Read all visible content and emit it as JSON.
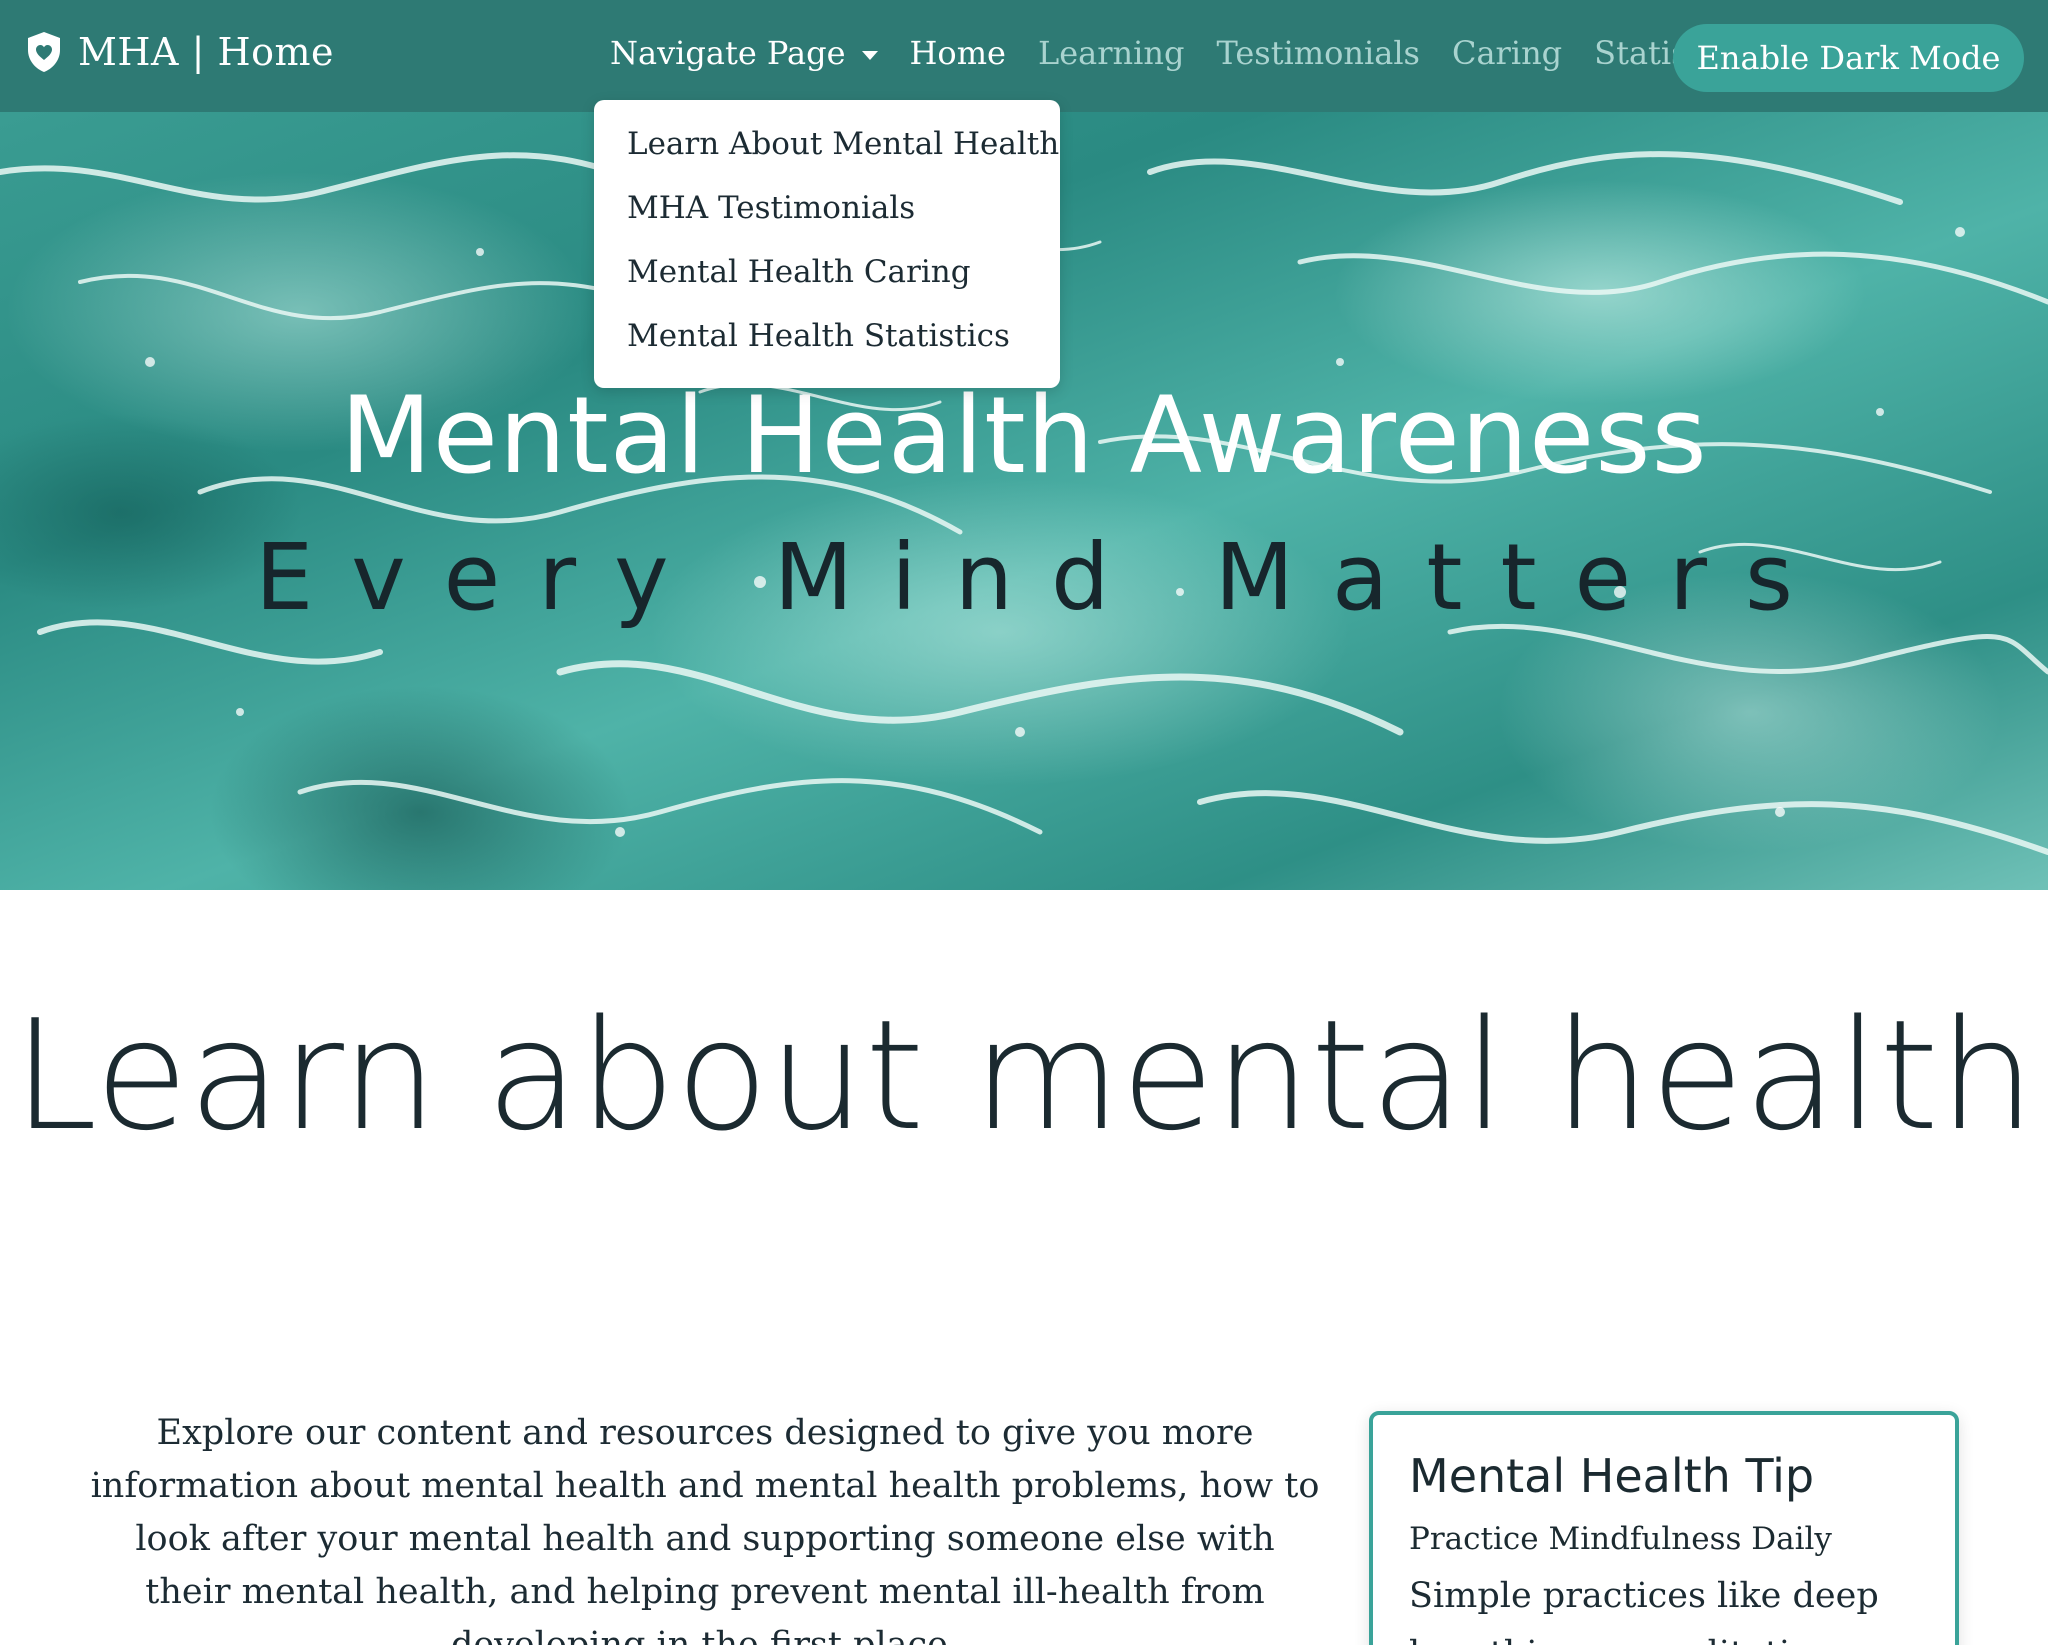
{
  "navbar": {
    "brand_text": "MHA | Home",
    "brand_icon": "shield-heart-icon",
    "dropdown_label": "Navigate Page",
    "links": [
      {
        "label": "Home",
        "active": true
      },
      {
        "label": "Learning",
        "active": false
      },
      {
        "label": "Testimonials",
        "active": false
      },
      {
        "label": "Caring",
        "active": false
      },
      {
        "label": "Statistics",
        "active": false
      }
    ],
    "dark_mode_button": "Enable Dark Mode"
  },
  "dropdown": {
    "items": [
      "Learn About Mental Health",
      "MHA Testimonials",
      "Mental Health Caring",
      "Mental Health Statistics"
    ]
  },
  "hero": {
    "title": "Mental Health Awareness",
    "subtitle": "Every Mind Matters"
  },
  "main": {
    "heading": "Learn about mental health",
    "intro": "Explore our content and resources designed to give you more information about mental health and mental health problems, how to look after your mental health and supporting someone else with their mental health, and helping prevent mental ill-health from developing in the first place."
  },
  "tip_card": {
    "heading": "Mental Health Tip",
    "subheading": "Practice Mindfulness Daily",
    "text": "Simple practices like deep breathing or meditation"
  },
  "colors": {
    "navbar": "#2e7a74",
    "accent": "#3aa399",
    "text": "#1c2b33"
  }
}
